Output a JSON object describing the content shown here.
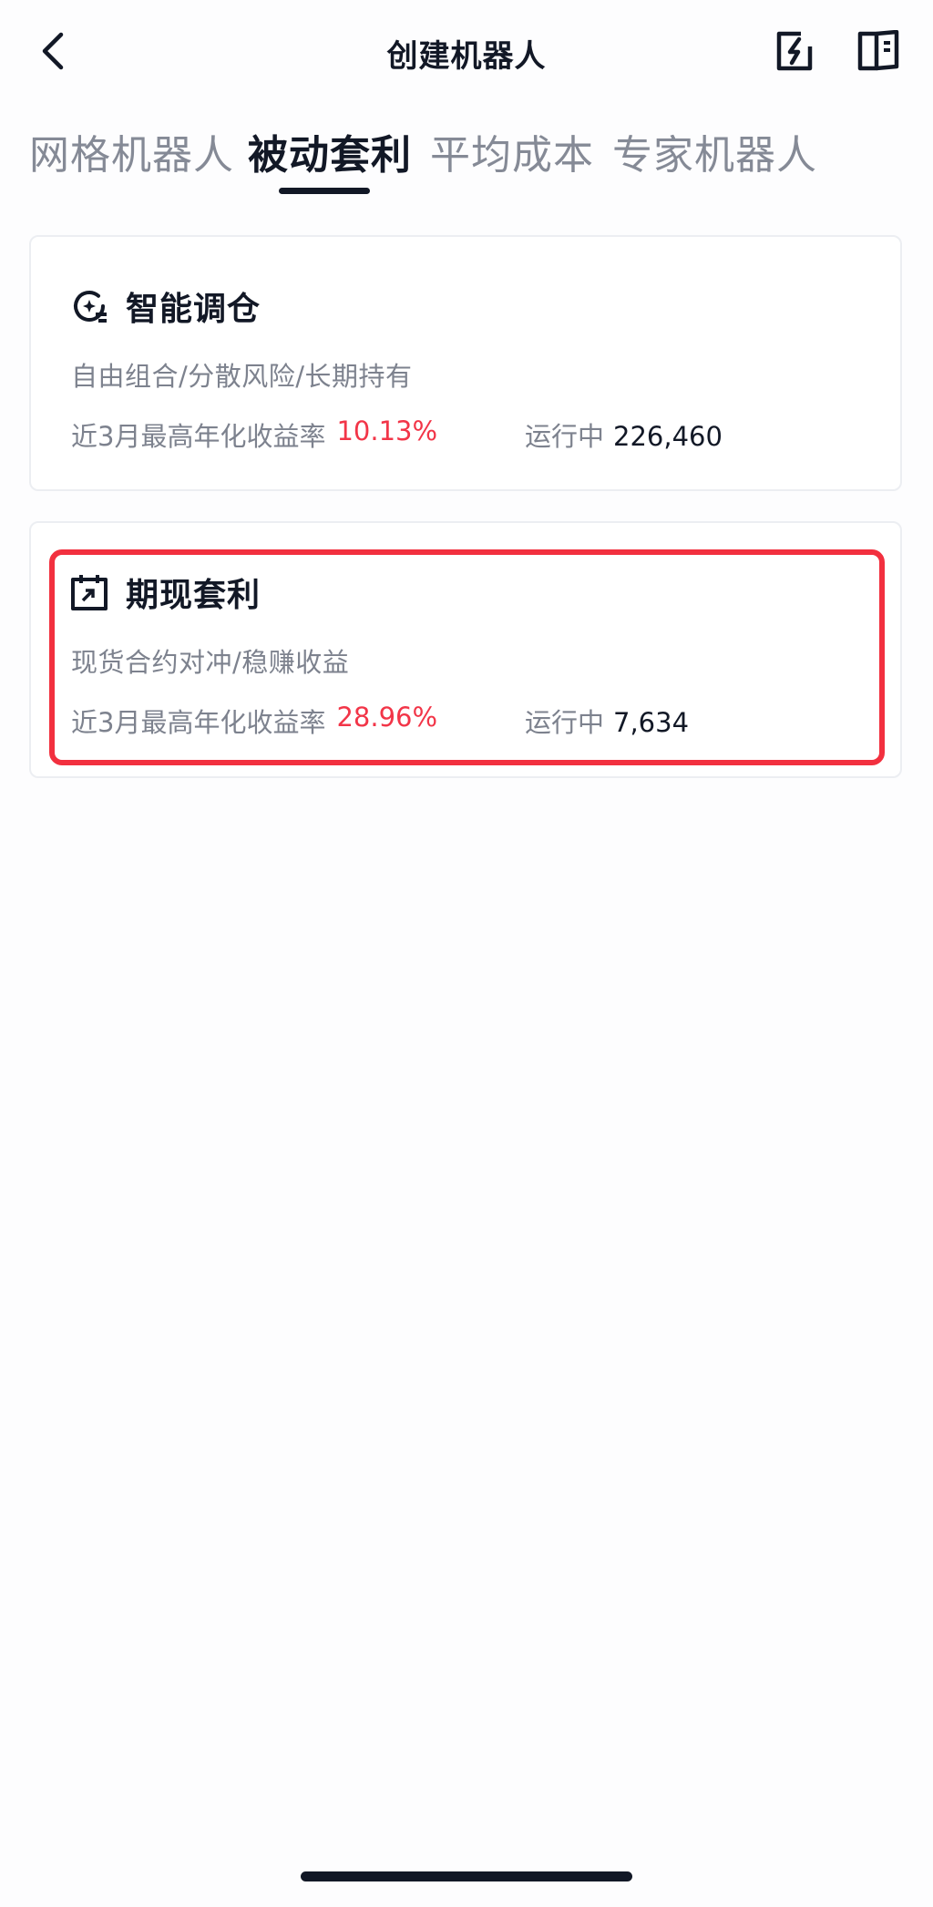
{
  "header": {
    "title": "创建机器人",
    "icons": {
      "back": "chevron-left-icon",
      "share": "share-icon",
      "guide": "book-icon"
    }
  },
  "tabs": [
    {
      "label": "网格机器人",
      "active": false
    },
    {
      "label": "被动套利",
      "active": true
    },
    {
      "label": "平均成本",
      "active": false
    },
    {
      "label": "专家机器人",
      "active": false
    }
  ],
  "cards": [
    {
      "title": "智能调仓",
      "icon": "rebalance-icon",
      "description": "自由组合/分散风险/长期持有",
      "rate_label": "近3月最高年化收益率",
      "rate_value": "10.13%",
      "running_label": "运行中",
      "running_value": "226,460",
      "highlighted": false
    },
    {
      "title": "期现套利",
      "icon": "calendar-arrow-icon",
      "description": "现货合约对冲/稳赚收益",
      "rate_label": "近3月最高年化收益率",
      "rate_value": "28.96%",
      "running_label": "运行中",
      "running_value": "7,634",
      "highlighted": true
    }
  ],
  "colors": {
    "accent_red": "#f23548",
    "highlight_border": "#f2303f",
    "text_primary": "#121826",
    "text_secondary": "#7d828e"
  }
}
